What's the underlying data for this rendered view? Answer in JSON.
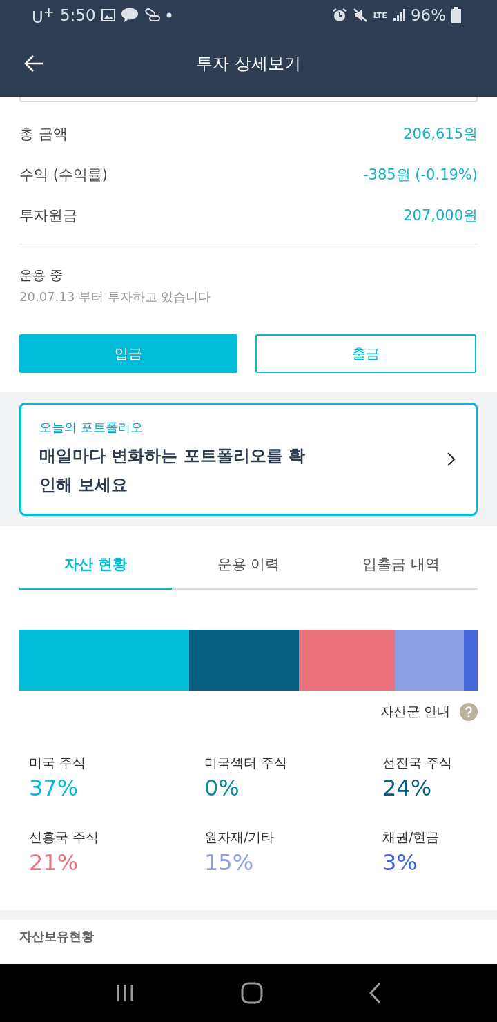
{
  "status_bar": {
    "carrier": "U$^{+}$",
    "time": "5:50",
    "network": "LTE",
    "battery": "96%"
  },
  "header": {
    "title": "투자 상세보기"
  },
  "summary": [
    {
      "label": "총 금액",
      "value": "206,615원"
    },
    {
      "label": "수익 (수익률)",
      "value": "-385원 (-0.19%)"
    },
    {
      "label": "투자원금",
      "value": "207,000원"
    }
  ],
  "status": {
    "title": "운용 중",
    "subtitle": "20.07.13 부터 투자하고 있습니다"
  },
  "buttons": [
    {
      "label": "입금",
      "kind": "primary"
    },
    {
      "label": "출금",
      "kind": "outline"
    }
  ],
  "portfolio_card": {
    "eyebrow": "오늘의 포트폴리오",
    "headline": "매일마다 변화하는 포트폴리오를 확인해 보세요"
  },
  "tabs": [
    {
      "label": "자산 현황",
      "selected": true
    },
    {
      "label": "운용 이력",
      "selected": false
    },
    {
      "label": "입출금 내역",
      "selected": false
    }
  ],
  "asset_info": "자산군 안내",
  "assets": [
    {
      "name": "미국 주식",
      "value": "37%",
      "color": "#00bcd6"
    },
    {
      "name": "미국섹터 주식",
      "value": "0%",
      "color": "#0e8a9c"
    },
    {
      "name": "선진국 주식",
      "value": "24%",
      "color": "#055e80"
    },
    {
      "name": "신흥국 주식",
      "value": "21%",
      "color": "#ec727e"
    },
    {
      "name": "원자재/기타",
      "value": "15%",
      "color": "#8c9fe3"
    },
    {
      "name": "채권/현금",
      "value": "3%",
      "color": "#4466d8"
    }
  ],
  "holdings_title": "자산보유현황"
}
